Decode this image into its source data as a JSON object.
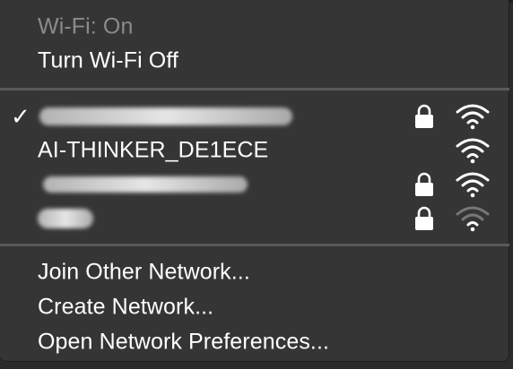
{
  "status": {
    "wifi_state": "Wi-Fi: On",
    "toggle_label": "Turn Wi-Fi Off"
  },
  "networks": [
    {
      "name": "",
      "redacted": true,
      "connected": true,
      "secured": true,
      "signal": "full",
      "icon": "wifi-full-icon"
    },
    {
      "name": "AI-THINKER_DE1ECE",
      "redacted": false,
      "connected": false,
      "secured": false,
      "signal": "full",
      "icon": "wifi-full-icon"
    },
    {
      "name": "",
      "redacted": true,
      "connected": false,
      "secured": true,
      "signal": "full",
      "icon": "wifi-full-icon"
    },
    {
      "name": "",
      "redacted": true,
      "connected": false,
      "secured": true,
      "signal": "weak",
      "icon": "wifi-weak-icon"
    }
  ],
  "actions": {
    "join_other": "Join Other Network...",
    "create_network": "Create Network...",
    "open_prefs": "Open Network Preferences..."
  },
  "icons": {
    "checkmark": "✓",
    "lock": "lock-icon"
  },
  "colors": {
    "menu_bg": "#353535",
    "text": "#ffffff",
    "disabled_text": "#8b8b8b",
    "separator": "#5a5a5a",
    "accent": "#4a8fd9"
  }
}
